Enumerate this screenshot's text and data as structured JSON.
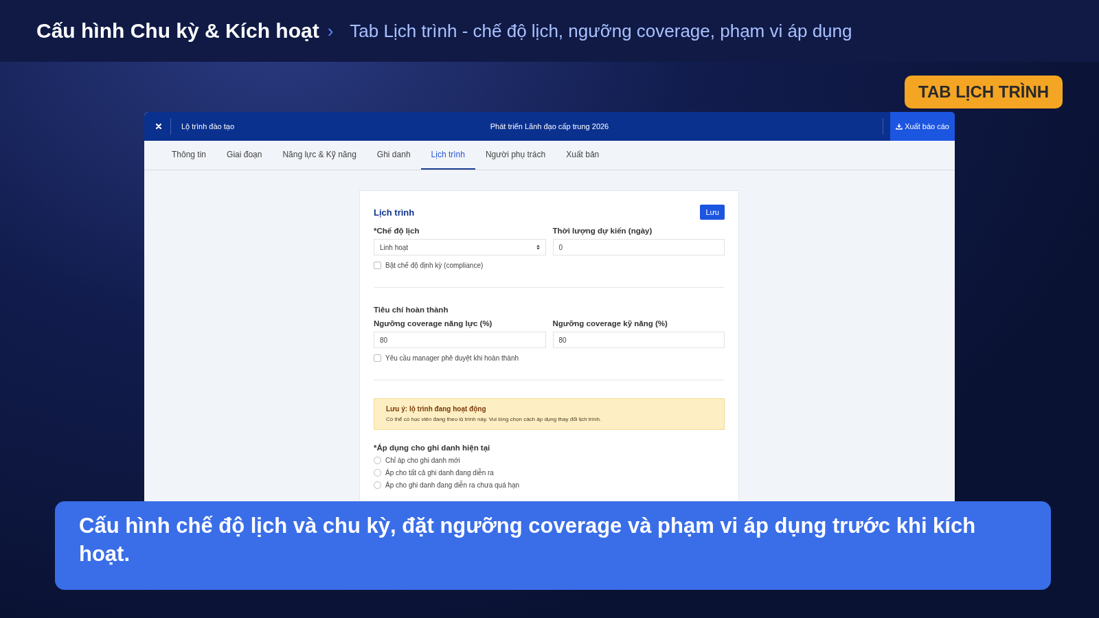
{
  "header": {
    "title": "Cấu hình Chu kỳ & Kích hoạt",
    "separator": "›",
    "subtitle": "Tab Lịch trình - chế độ lịch, ngưỡng coverage, phạm vi áp dụng"
  },
  "badge": "TAB LỊCH TRÌNH",
  "window": {
    "breadcrumb": "Lộ trình đào tạo",
    "title": "Phát triển Lãnh đạo cấp trung 2026",
    "export_button": "Xuất báo cáo"
  },
  "tabs": [
    {
      "label": "Thông tin",
      "selected": false
    },
    {
      "label": "Giai đoạn",
      "selected": false
    },
    {
      "label": "Năng lực & Kỹ năng",
      "selected": false
    },
    {
      "label": "Ghi danh",
      "selected": false
    },
    {
      "label": "Lịch trình",
      "selected": true
    },
    {
      "label": "Người phụ trách",
      "selected": false
    },
    {
      "label": "Xuất bản",
      "selected": false
    }
  ],
  "form": {
    "title": "Lịch trình",
    "save_button": "Lưu",
    "schedule_mode": {
      "label": "*Chế độ lịch",
      "value": "Linh hoạt"
    },
    "duration": {
      "label": "Thời lượng dự kiến (ngày)",
      "value": "0"
    },
    "compliance": {
      "label": "Bật chế độ định kỳ (compliance)",
      "checked": false
    },
    "criteria_title": "Tiêu chí hoàn thành",
    "competency_threshold": {
      "label": "Ngưỡng coverage năng lực (%)",
      "value": "80"
    },
    "skill_threshold": {
      "label": "Ngưỡng coverage kỹ năng (%)",
      "value": "80"
    },
    "manager_approval": {
      "label": "Yêu cầu manager phê duyệt khi hoàn thành",
      "checked": false
    },
    "notice": {
      "title": "Lưu ý: lộ trình đang hoạt động",
      "text": "Có thể có học viên đang theo lộ trình này. Vui lòng chọn cách áp dụng thay đổi lịch trình."
    },
    "apply_label": "*Áp dụng cho ghi danh hiện tại",
    "apply_options": [
      {
        "label": "Chỉ áp cho ghi danh mới",
        "selected": false
      },
      {
        "label": "Áp cho tất cả ghi danh đang diễn ra",
        "selected": false
      },
      {
        "label": "Áp cho ghi danh đang diễn ra chưa quá hạn",
        "selected": false
      }
    ]
  },
  "caption": "Cấu hình chế độ lịch và chu kỳ, đặt ngưỡng coverage và phạm vi áp dụng trước khi kích hoạt."
}
